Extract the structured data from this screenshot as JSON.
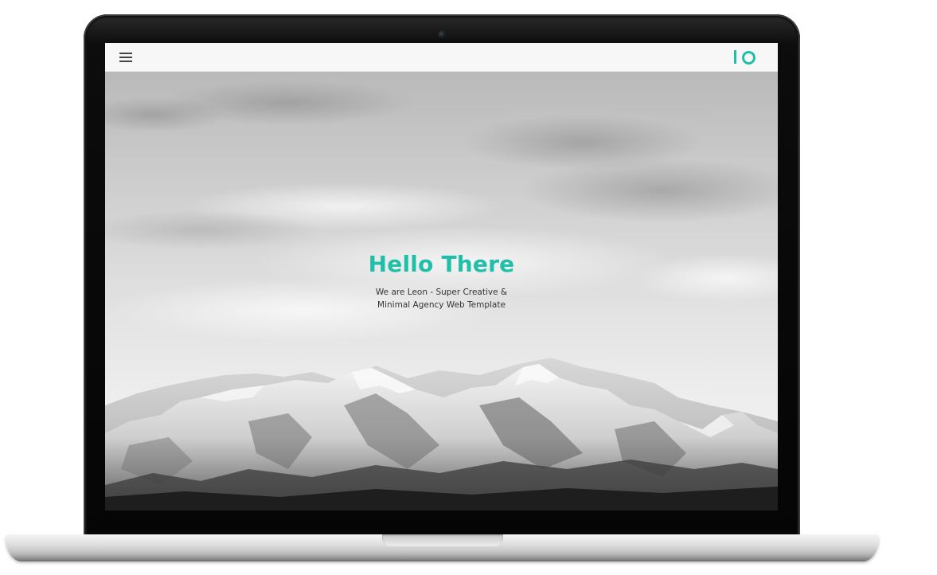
{
  "device": {
    "type": "laptop"
  },
  "header": {
    "menu_icon": "hamburger-menu-icon",
    "logo_icon": "io-logo-icon",
    "accent_color": "#1fbfa9"
  },
  "hero": {
    "title": "Hello There",
    "subtitle_line1": "We are Leon - Super Creative &",
    "subtitle_line2": "Minimal Agency Web Template",
    "background": "black-and-white snowy mountain range under cloudy sky"
  }
}
